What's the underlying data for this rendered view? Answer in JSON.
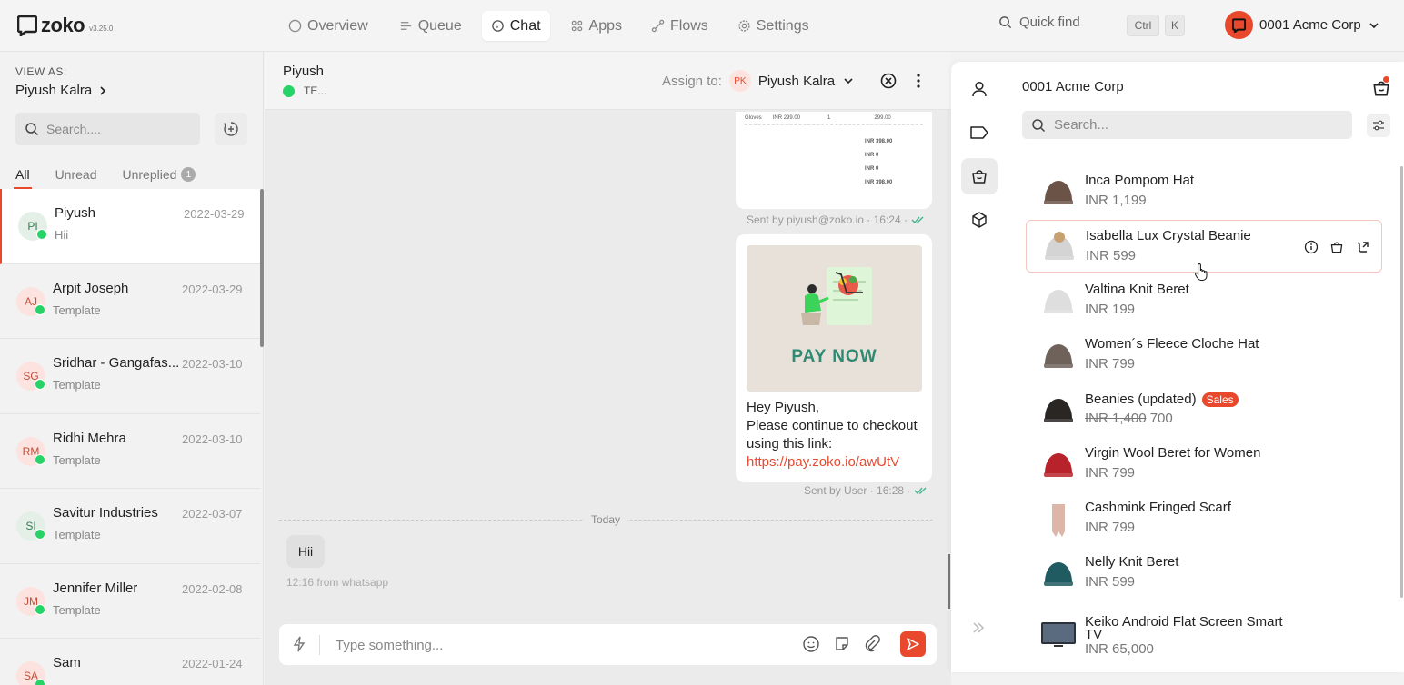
{
  "app": {
    "brand": "zoko",
    "version": "v3.25.0",
    "nav": [
      {
        "label": "Overview",
        "icon": "circle-icon"
      },
      {
        "label": "Queue",
        "icon": "queue-icon"
      },
      {
        "label": "Chat",
        "icon": "chat-icon",
        "active": true
      },
      {
        "label": "Apps",
        "icon": "apps-icon"
      },
      {
        "label": "Flows",
        "icon": "flows-icon"
      },
      {
        "label": "Settings",
        "icon": "gear-icon"
      }
    ],
    "quickfind": "Quick find",
    "kbd_ctrl": "Ctrl",
    "kbd_k": "K",
    "account": "0001 Acme Corp",
    "accent": "#e8492d"
  },
  "sidebar": {
    "viewas_label": "VIEW AS:",
    "viewas_name": "Piyush Kalra",
    "search_placeholder": "Search....",
    "tabs": [
      {
        "label": "All",
        "active": true
      },
      {
        "label": "Unread"
      },
      {
        "label": "Unreplied",
        "badge": "1"
      }
    ],
    "chats": [
      {
        "initials": "PI",
        "name": "Piyush",
        "date": "2022-03-29",
        "preview": "Hii",
        "avatar_bg": "#e3efe7",
        "avatar_fg": "#3c7a55",
        "active": true
      },
      {
        "initials": "AJ",
        "name": "Arpit Joseph",
        "date": "2022-03-29",
        "preview": "Template",
        "avatar_bg": "#fde3df",
        "avatar_fg": "#c0503b"
      },
      {
        "initials": "SG",
        "name": "Sridhar - Gangafas...",
        "date": "2022-03-10",
        "preview": "Template",
        "avatar_bg": "#fde3df",
        "avatar_fg": "#c0503b"
      },
      {
        "initials": "RM",
        "name": "Ridhi Mehra",
        "date": "2022-03-10",
        "preview": "Template",
        "avatar_bg": "#fde3df",
        "avatar_fg": "#c0503b"
      },
      {
        "initials": "SI",
        "name": "Savitur Industries",
        "date": "2022-03-07",
        "preview": "Template",
        "avatar_bg": "#e3efe7",
        "avatar_fg": "#3c7a55"
      },
      {
        "initials": "JM",
        "name": "Jennifer Miller",
        "date": "2022-02-08",
        "preview": "Template",
        "avatar_bg": "#fde3df",
        "avatar_fg": "#c0503b"
      },
      {
        "initials": "SA",
        "name": "Sam",
        "date": "2022-01-24",
        "preview": "",
        "avatar_bg": "#fde3df",
        "avatar_fg": "#c0503b"
      }
    ]
  },
  "chat": {
    "contact_name": "Piyush",
    "contact_sub": "TE...",
    "assign_label": "Assign to:",
    "assignee_initials": "PK",
    "assignee_name": "Piyush Kalra",
    "invoice": {
      "row_item": "Gloves",
      "row_price": "INR 299.00",
      "row_qty": "1",
      "row_total": "299.00",
      "totals": [
        "INR 398.00",
        "INR 0",
        "INR 0",
        "INR 398.00"
      ]
    },
    "invoice_meta": "Sent by piyush@zoko.io · 16:24 ·",
    "pay_image_text": "PAY NOW",
    "pay_line1": "Hey Piyush,",
    "pay_line2": "Please continue to checkout",
    "pay_line3": "using this link:",
    "pay_link": "https://pay.zoko.io/awUtV",
    "pay_meta": "Sent by User · 16:28 ·",
    "day_divider": "Today",
    "incoming_text": "Hii",
    "incoming_meta": "12:16 from whatsapp",
    "composer_placeholder": "Type something..."
  },
  "catalog": {
    "title": "0001 Acme Corp",
    "search_placeholder": "Search...",
    "products": [
      {
        "name": "Inca Pompom Hat",
        "price": "INR 1,199",
        "thumb_color": "#6b5348"
      },
      {
        "name": "Isabella Lux Crystal Beanie",
        "price": "INR 599",
        "thumb_color": "#d4d4d4",
        "hover": true
      },
      {
        "name": "Valtina Knit Beret",
        "price": "INR 199",
        "thumb_color": "#dedede"
      },
      {
        "name": "Women´s Fleece Cloche Hat",
        "price": "INR 799",
        "thumb_color": "#6e625a"
      },
      {
        "name": "Beanies (updated)",
        "badge": "Sales",
        "price_old": "INR 1,400",
        "price_new": "700",
        "thumb_color": "#2a2624"
      },
      {
        "name": "Virgin Wool Beret for Women",
        "price": "INR 799",
        "thumb_color": "#b8232b"
      },
      {
        "name": "Cashmink Fringed Scarf",
        "price": "INR 799",
        "thumb_color": "#dcb6a8"
      },
      {
        "name": "Nelly Knit Beret",
        "price": "INR 599",
        "thumb_color": "#1f5b60"
      },
      {
        "name": "Keiko Android Flat Screen Smart TV",
        "price": "INR 65,000",
        "thumb_color": "#2c3139"
      }
    ]
  }
}
